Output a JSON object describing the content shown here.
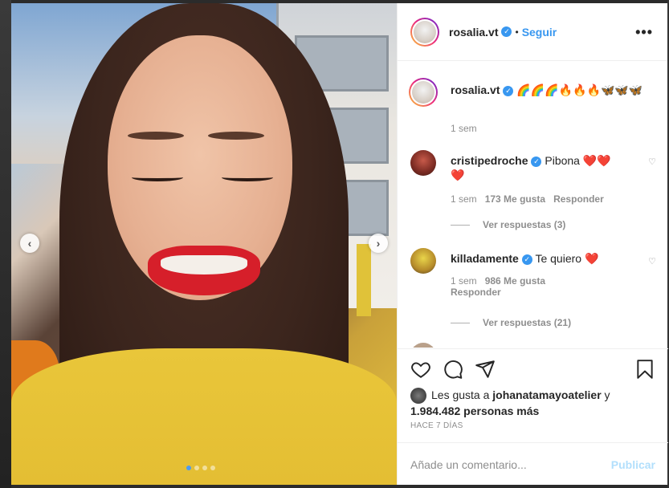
{
  "post": {
    "nav_prev": "‹",
    "nav_next": "›",
    "carousel_dots": 4,
    "carousel_active": 1
  },
  "header": {
    "username": "rosalia.vt",
    "separator": "•",
    "follow_label": "Seguir",
    "more_label": "•••"
  },
  "caption": {
    "username": "rosalia.vt",
    "text": "🌈🌈🌈🔥🔥🔥🦋🦋🦋",
    "time": "1 sem"
  },
  "comments": [
    {
      "username": "cristipedroche",
      "text": "Pibona ❤️❤️❤️",
      "time": "1 sem",
      "likes": "173 Me gusta",
      "reply_label": "Responder",
      "view_replies": "Ver respuestas (3)"
    },
    {
      "username": "killadamente",
      "text": "Te quiero ❤️",
      "time": "1 sem",
      "likes": "986 Me gusta",
      "reply_label": "Responder",
      "view_replies": "Ver respuestas (21)"
    }
  ],
  "actions": {
    "like_icon": "heart-icon",
    "comment_icon": "comment-icon",
    "share_icon": "paper-plane-icon",
    "save_icon": "bookmark-icon"
  },
  "likes": {
    "prefix": "Les gusta a ",
    "user": "johanatamayoatelier",
    "connector": " y",
    "count": "1.984.482 personas más"
  },
  "timestamp": "HACE 7 DÍAS",
  "comment_box": {
    "placeholder": "Añade un comentario...",
    "publish_label": "Publicar"
  },
  "colors": {
    "accent": "#3897f0",
    "publish_disabled": "#b2dffc",
    "lips": "#d61f2a",
    "shirt": "#e9c63a"
  }
}
